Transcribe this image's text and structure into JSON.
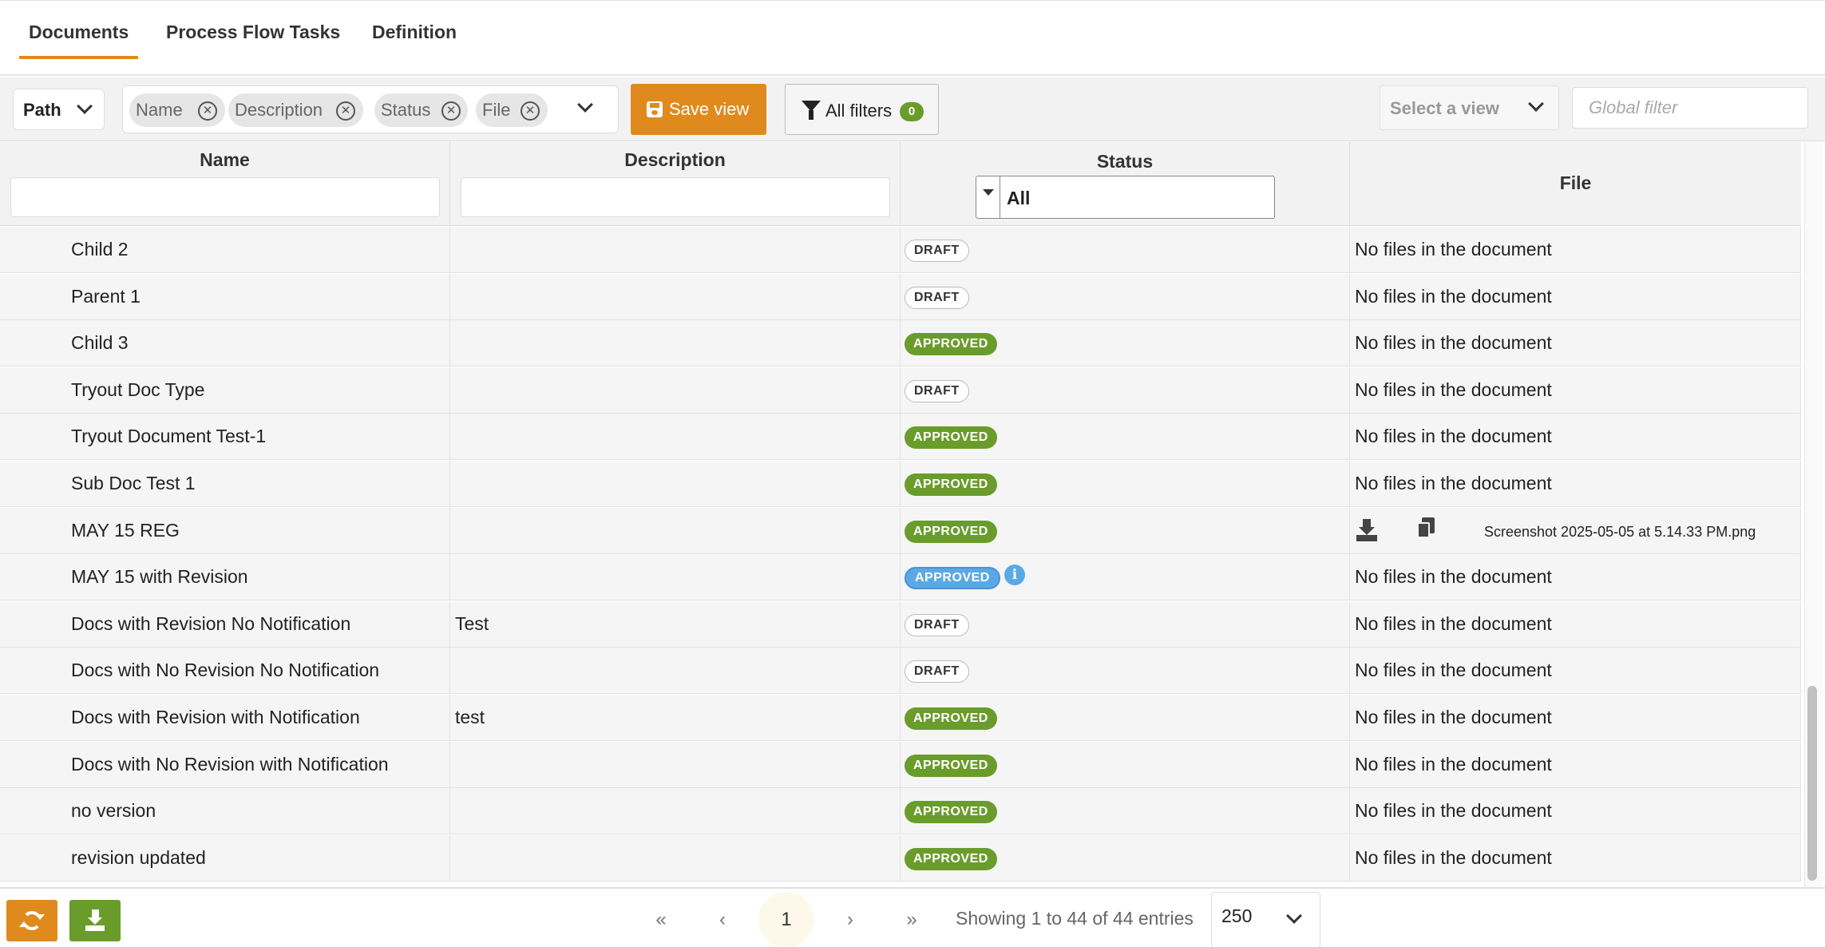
{
  "tabs": [
    {
      "label": "Documents",
      "active": true
    },
    {
      "label": "Process Flow Tasks",
      "active": false
    },
    {
      "label": "Definition",
      "active": false
    }
  ],
  "toolbar": {
    "path_label": "Path",
    "column_chips": [
      "Name",
      "Description",
      "Status",
      "File"
    ],
    "save_view_label": "Save view",
    "all_filters_label": "All filters",
    "all_filters_count": "0",
    "select_view_placeholder": "Select a view",
    "global_filter_placeholder": "Global filter"
  },
  "table": {
    "columns": {
      "name": "Name",
      "description": "Description",
      "status": "Status",
      "file": "File"
    },
    "status_filter_value": "All",
    "rows": [
      {
        "name": "Child 2",
        "description": "",
        "status": "DRAFT",
        "file": "No files in the document"
      },
      {
        "name": "Parent 1",
        "description": "",
        "status": "DRAFT",
        "file": "No files in the document"
      },
      {
        "name": "Child 3",
        "description": "",
        "status": "APPROVED",
        "file": "No files in the document"
      },
      {
        "name": "Tryout Doc Type",
        "description": "",
        "status": "DRAFT",
        "file": "No files in the document"
      },
      {
        "name": "Tryout Document Test-1",
        "description": "",
        "status": "APPROVED",
        "file": "No files in the document"
      },
      {
        "name": "Sub Doc Test 1",
        "description": "",
        "status": "APPROVED",
        "file": "No files in the document"
      },
      {
        "name": "MAY 15 REG",
        "description": "",
        "status": "APPROVED",
        "file": "Screenshot 2025-05-05 at 5.14.33 PM.png"
      },
      {
        "name": "MAY 15 with Revision",
        "description": "",
        "status": "APPROVED",
        "file": "No files in the document"
      },
      {
        "name": "Docs with Revision No Notification",
        "description": "Test",
        "status": "DRAFT",
        "file": "No files in the document"
      },
      {
        "name": "Docs with No Revision No Notification",
        "description": "",
        "status": "DRAFT",
        "file": "No files in the document"
      },
      {
        "name": "Docs with Revision with Notification",
        "description": "test",
        "status": "APPROVED",
        "file": "No files in the document"
      },
      {
        "name": "Docs with No Revision with Notification",
        "description": "",
        "status": "APPROVED",
        "file": "No files in the document"
      },
      {
        "name": "no version",
        "description": "",
        "status": "APPROVED",
        "file": "No files in the document"
      },
      {
        "name": "revision updated",
        "description": "",
        "status": "APPROVED",
        "file": "No files in the document"
      }
    ]
  },
  "pagination": {
    "first": "«",
    "prev": "‹",
    "current_page": "1",
    "next": "›",
    "last": "»",
    "entries_text": "Showing 1 to 44 of 44 entries",
    "page_size": "250"
  },
  "colors": {
    "accent_orange": "#e08a1e",
    "approved_green": "#6a9c2b",
    "info_blue": "#5aa9e6"
  },
  "icons": {
    "save": "floppy-disk-icon",
    "filter": "funnel-icon",
    "remove_chip": "close-circle-icon",
    "download": "download-icon",
    "copy": "copy-icon",
    "info": "info-icon",
    "refresh": "refresh-icon",
    "export": "export-download-icon"
  }
}
